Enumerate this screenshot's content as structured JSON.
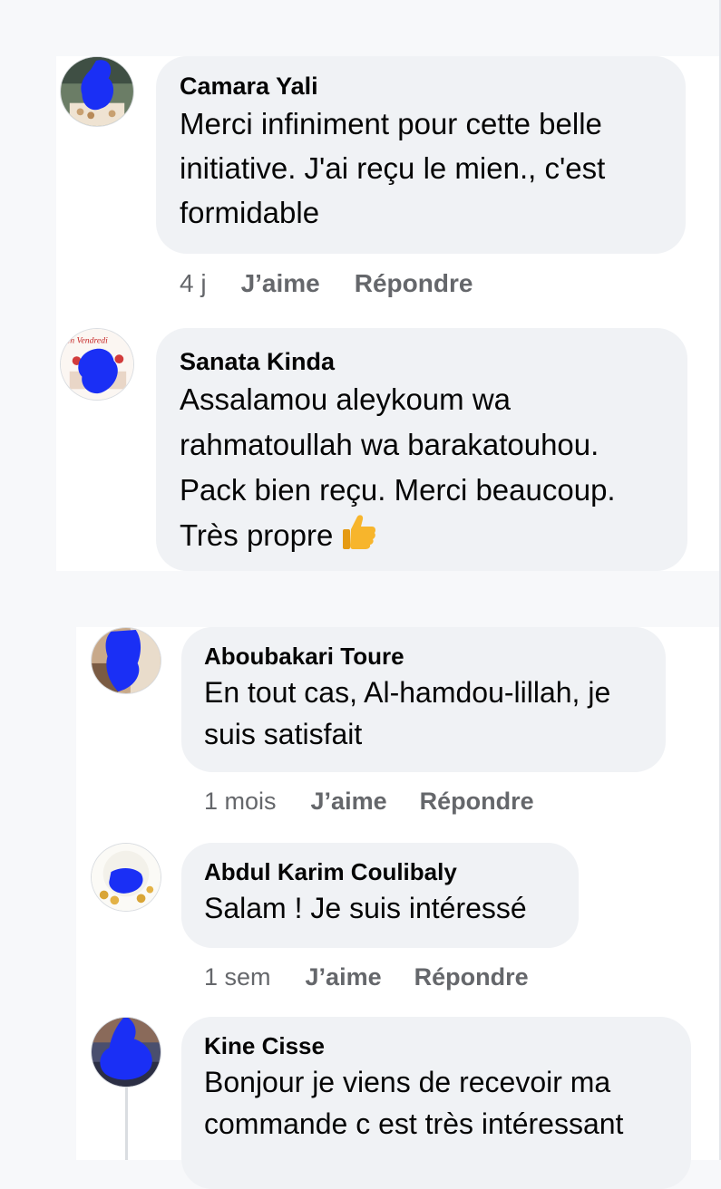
{
  "comments": [
    {
      "author": "Camara Yali",
      "lines": [
        "Merci infiniment pour cette belle",
        "initiative. J'ai reçu le mien., c'est",
        "formidable"
      ],
      "time": "4 j",
      "like": "J’aime",
      "reply": "Répondre"
    },
    {
      "author": "Sanata Kinda",
      "lines": [
        "Assalamou aleykoum wa",
        "rahmatoullah wa barakatouhou.",
        "Pack bien reçu. Merci beaucoup.",
        "Très propre"
      ],
      "emoji": "thumbs-up-emoji",
      "avatar_text": "en Vendredi"
    },
    {
      "author": "Aboubakari Toure",
      "lines": [
        "En tout cas, Al-hamdou-lillah, je",
        "suis satisfait"
      ],
      "time": "1 mois",
      "like": "J’aime",
      "reply": "Répondre"
    },
    {
      "author": "Abdul Karim Coulibaly",
      "lines": [
        "Salam ! Je suis intéressé"
      ],
      "time": "1 sem",
      "like": "J’aime",
      "reply": "Répondre"
    },
    {
      "author": "Kine Cisse",
      "lines": [
        "Bonjour je viens de recevoir ma",
        "commande c est très intéressant"
      ]
    }
  ],
  "colors": {
    "bubble": "#f0f2f5",
    "meta": "#65676b",
    "redaction": "#1a2ff5"
  }
}
